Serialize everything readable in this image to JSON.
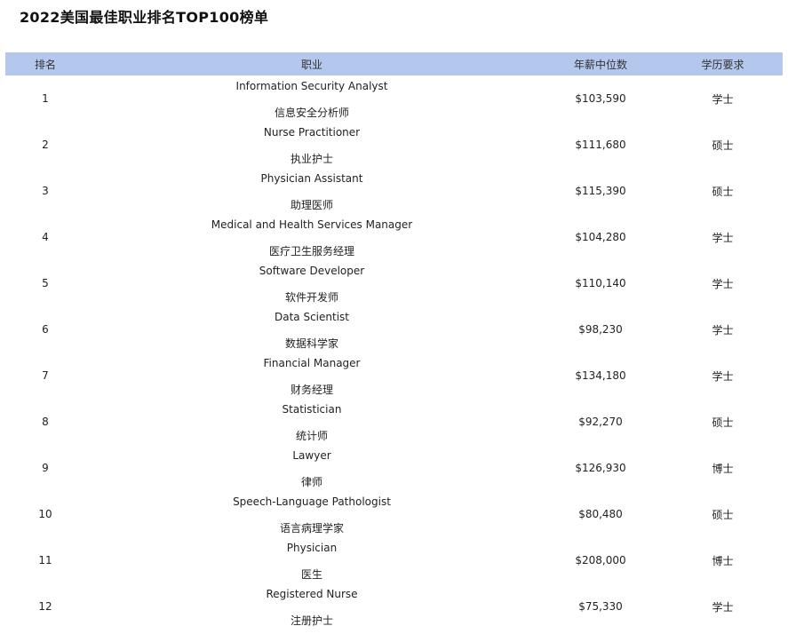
{
  "page": {
    "title": "2022美国最佳职业排名TOP100榜单"
  },
  "table": {
    "headers": {
      "rank": "排名",
      "job": "职业",
      "salary": "年薪中位数",
      "education": "学历要求"
    },
    "rows": [
      {
        "rank": "1",
        "en": "Information Security Analyst",
        "cn": "信息安全分析师",
        "salary": "$103,590",
        "education": "学士"
      },
      {
        "rank": "2",
        "en": "Nurse Practitioner",
        "cn": "执业护士",
        "salary": "$111,680",
        "education": "硕士"
      },
      {
        "rank": "3",
        "en": "Physician Assistant",
        "cn": "助理医师",
        "salary": "$115,390",
        "education": "硕士"
      },
      {
        "rank": "4",
        "en": "Medical and Health Services Manager",
        "cn": "医疗卫生服务经理",
        "salary": "$104,280",
        "education": "学士"
      },
      {
        "rank": "5",
        "en": "Software Developer",
        "cn": "软件开发师",
        "salary": "$110,140",
        "education": "学士"
      },
      {
        "rank": "6",
        "en": "Data Scientist",
        "cn": "数据科学家",
        "salary": "$98,230",
        "education": "学士"
      },
      {
        "rank": "7",
        "en": "Financial Manager",
        "cn": "财务经理",
        "salary": "$134,180",
        "education": "学士"
      },
      {
        "rank": "8",
        "en": "Statistician",
        "cn": "统计师",
        "salary": "$92,270",
        "education": "硕士"
      },
      {
        "rank": "9",
        "en": "Lawyer",
        "cn": "律师",
        "salary": "$126,930",
        "education": "博士"
      },
      {
        "rank": "10",
        "en": "Speech-Language Pathologist",
        "cn": "语言病理学家",
        "salary": "$80,480",
        "education": "硕士"
      },
      {
        "rank": "11",
        "en": "Physician",
        "cn": "医生",
        "salary": "$208,000",
        "education": "博士"
      },
      {
        "rank": "12",
        "en": "Registered Nurse",
        "cn": "注册护士",
        "salary": "$75,330",
        "education": "学士"
      }
    ]
  }
}
